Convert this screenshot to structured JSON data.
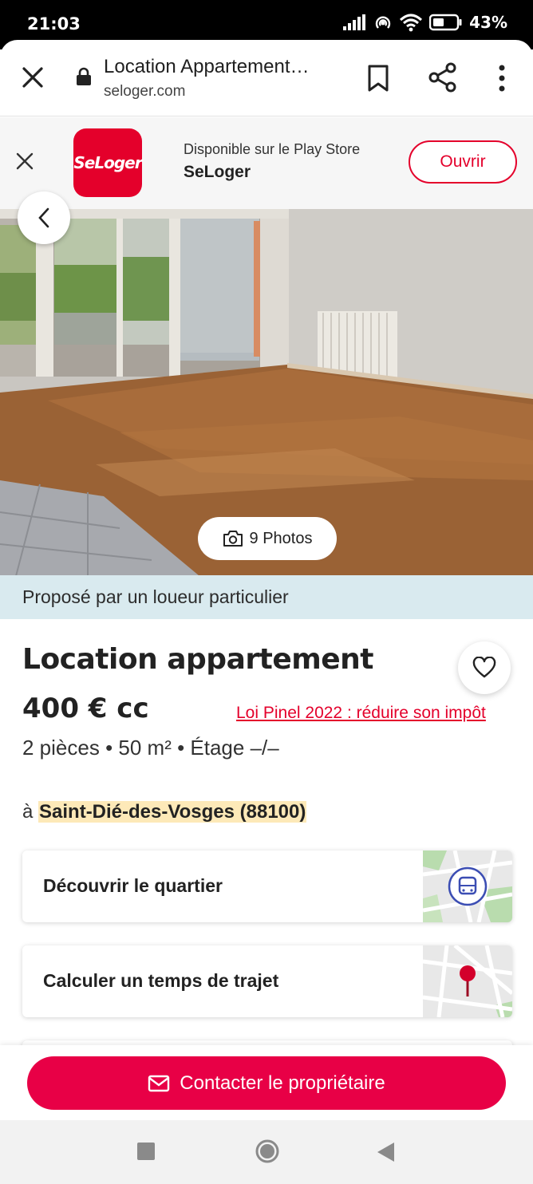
{
  "status_bar": {
    "time": "21:03",
    "battery_text": "43%",
    "icons": [
      "signal-icon",
      "hotspot-icon",
      "wifi-icon",
      "battery-icon"
    ]
  },
  "browser": {
    "page_title": "Location Appartement…",
    "url": "seloger.com"
  },
  "app_banner": {
    "logo_text": "SeLoger",
    "availability": "Disponible sur le Play Store",
    "app_name": "SeLoger",
    "open_label": "Ouvrir"
  },
  "photo": {
    "photos_label": "9 Photos"
  },
  "owner_band": {
    "text": "Proposé par un loueur particulier"
  },
  "listing": {
    "title": "Location appartement",
    "price": "400 € cc",
    "pinel_link": "Loi Pinel 2022 : réduire son impôt",
    "features": "2 pièces • 50 m² • Étage –/–",
    "location_prefix": "à ",
    "location_city": "Saint-Dié-des-Vosges (88100)"
  },
  "cards": {
    "neighborhood": "Découvrir le quartier",
    "travel_time": "Calculer un temps de trajet"
  },
  "cta": {
    "contact_label": "Contacter le propriétaire"
  },
  "colors": {
    "brand_red": "#e4002b",
    "cta_red": "#e80046",
    "owner_band_bg": "#d9eaef",
    "location_highlight": "#fde9b8"
  }
}
